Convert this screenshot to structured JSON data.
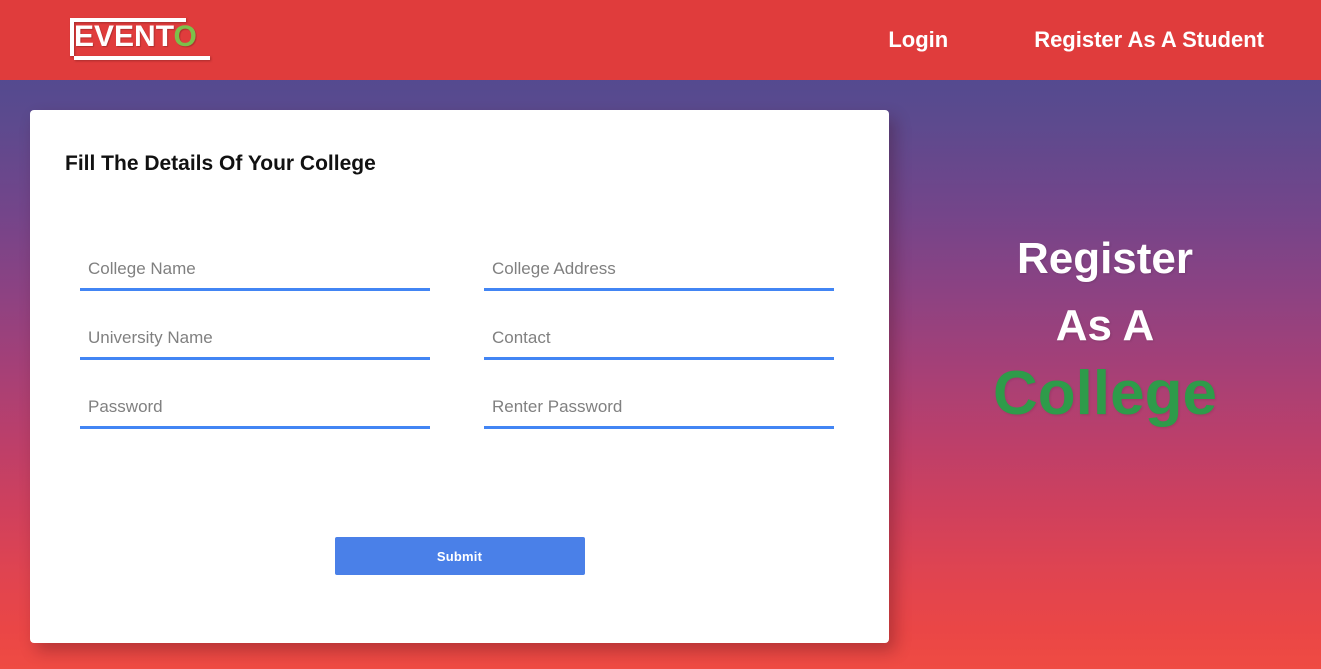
{
  "navbar": {
    "logo": {
      "text_main": "EVENT",
      "text_accent": "O",
      "accent_color": "#7cc04a",
      "full_text": "EVENTO"
    },
    "background_color": "#e03c3c",
    "links": [
      {
        "label": "Login",
        "name": "login"
      },
      {
        "label": "Register As A Student",
        "name": "register-as-a-student"
      }
    ]
  },
  "card": {
    "title": "Fill The Details Of Your College",
    "fields": [
      {
        "placeholder": "College Name",
        "value": "",
        "type": "text",
        "name": "college-name"
      },
      {
        "placeholder": "College Address",
        "value": "",
        "type": "text",
        "name": "college-address"
      },
      {
        "placeholder": "University Name",
        "value": "",
        "type": "text",
        "name": "university-name"
      },
      {
        "placeholder": "Contact",
        "value": "",
        "type": "text",
        "name": "contact"
      },
      {
        "placeholder": "Password",
        "value": "",
        "type": "password",
        "name": "password"
      },
      {
        "placeholder": "Renter Password",
        "value": "",
        "type": "password",
        "name": "renter-password"
      }
    ],
    "submit_label": "Submit",
    "submit_color": "#4a80e8",
    "field_underline_color": "#4285f4",
    "placeholder_color": "#808080"
  },
  "hero": {
    "line1": "Register",
    "line2": "As A",
    "line3": "College",
    "accent_color": "#2e9b4a",
    "text_color": "#ffffff"
  },
  "background": {
    "gradient_top": "#4a4e91",
    "gradient_mid": "#a54077",
    "gradient_bottom": "#ef4b43"
  }
}
